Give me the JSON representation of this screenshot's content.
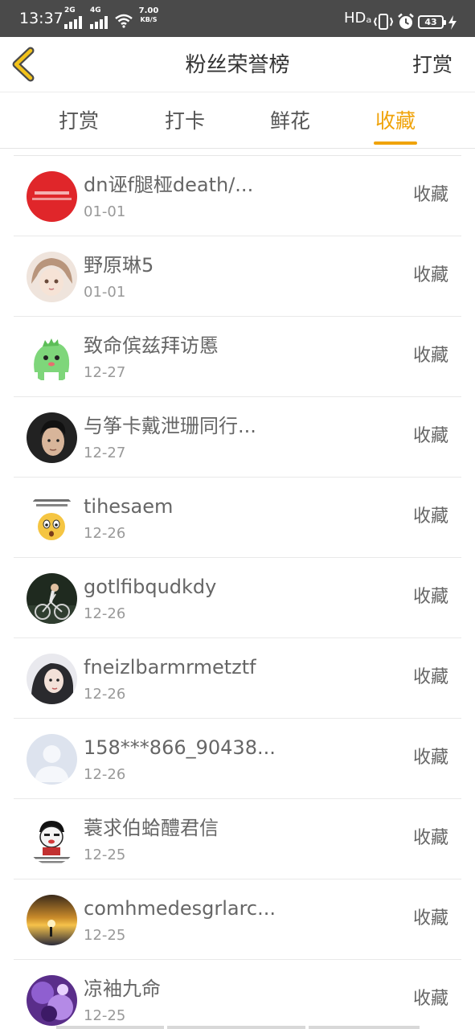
{
  "status_bar": {
    "time": "13:37",
    "network_1": "2G",
    "network_2": "4G",
    "speed_value": "7.00",
    "speed_unit": "KB/S",
    "hd_label": "HDₐ",
    "battery": "43"
  },
  "header": {
    "title": "粉丝荣誉榜",
    "action": "打赏"
  },
  "tabs": [
    {
      "label": "打赏",
      "active": false
    },
    {
      "label": "打卡",
      "active": false
    },
    {
      "label": "鲜花",
      "active": false
    },
    {
      "label": "收藏",
      "active": true
    }
  ],
  "colors": {
    "accent": "#f0a30a",
    "status_bar": "#4a4a4a"
  },
  "list": {
    "items": [
      {
        "name": "dn诬f腿桠death/...",
        "date": "01-01",
        "action": "收藏",
        "avatar": "red-badge-avatar"
      },
      {
        "name": "野原琳5",
        "date": "01-01",
        "action": "收藏",
        "avatar": "anime-girl-avatar"
      },
      {
        "name": "致命傧兹拜访慝",
        "date": "12-27",
        "action": "收藏",
        "avatar": "green-dinosaur-avatar"
      },
      {
        "name": "与筝卡戴泄珊同行...",
        "date": "12-27",
        "action": "收藏",
        "avatar": "man-portrait-avatar"
      },
      {
        "name": "tihesaem",
        "date": "12-26",
        "action": "收藏",
        "avatar": "emoji-meme-avatar"
      },
      {
        "name": "gotlfibqudkdy",
        "date": "12-26",
        "action": "收藏",
        "avatar": "cyclist-avatar"
      },
      {
        "name": "fneizlbarmrmetztf",
        "date": "12-26",
        "action": "收藏",
        "avatar": "drawn-girl-avatar"
      },
      {
        "name": "158***866_90438...",
        "date": "12-26",
        "action": "收藏",
        "avatar": "default-user-avatar"
      },
      {
        "name": "蓑求伯蛤醴君信",
        "date": "12-25",
        "action": "收藏",
        "avatar": "meme-face-avatar"
      },
      {
        "name": "comhmedesgrlarc...",
        "date": "12-25",
        "action": "收藏",
        "avatar": "sunset-avatar"
      },
      {
        "name": "凉袖九命",
        "date": "12-25",
        "action": "收藏",
        "avatar": "purple-art-avatar"
      }
    ]
  }
}
